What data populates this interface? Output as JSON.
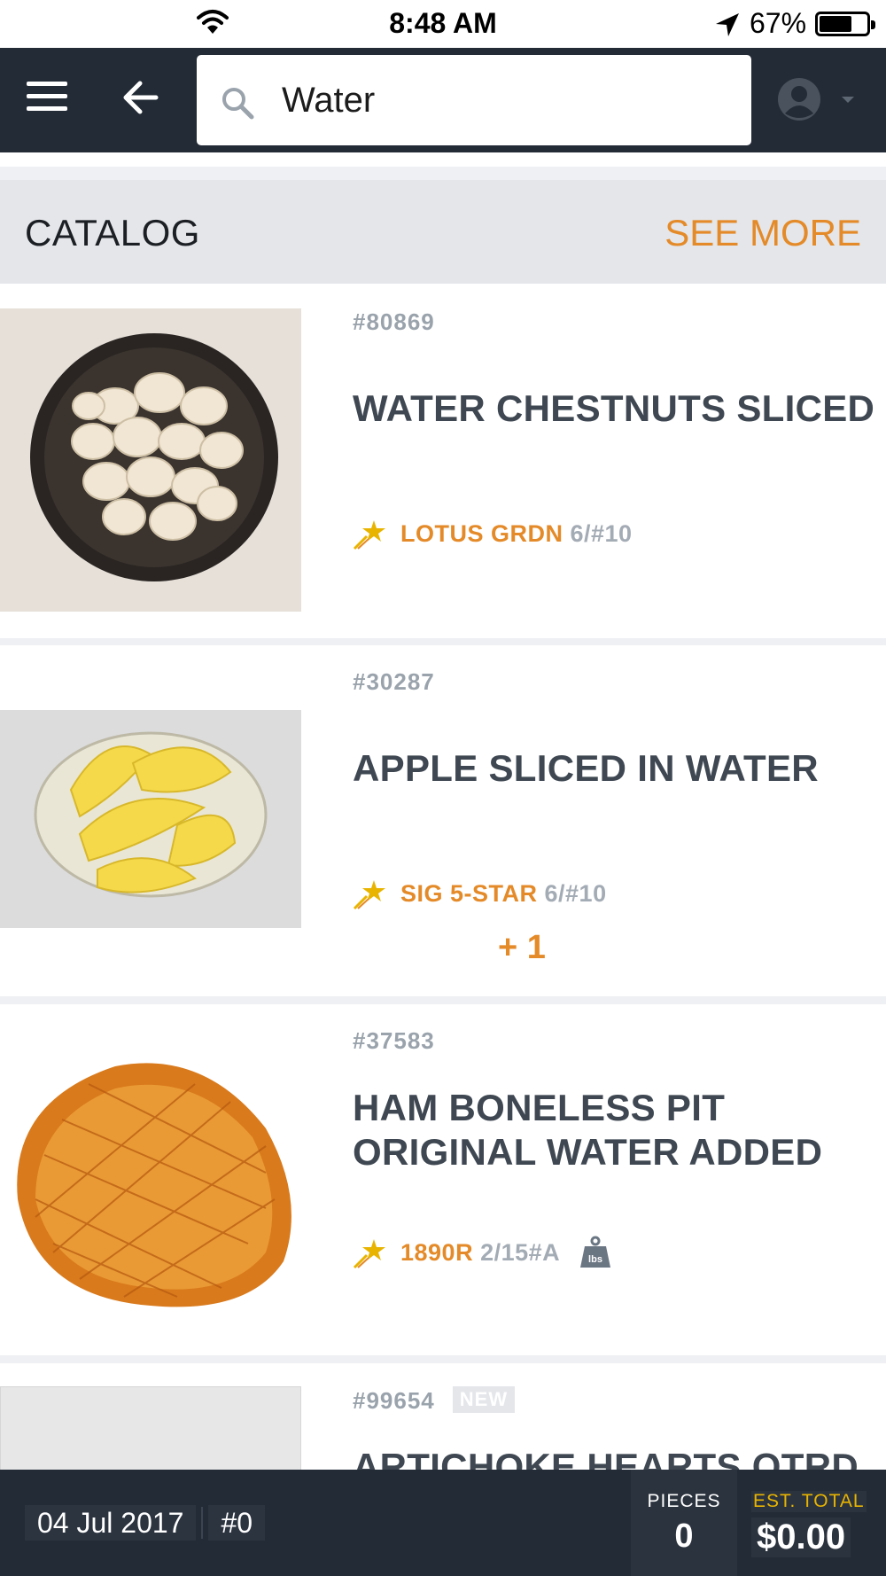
{
  "status_bar": {
    "time": "8:48 AM",
    "battery": "67%"
  },
  "header": {
    "search_value": "Water",
    "icons": [
      "menu-icon",
      "back-arrow-icon",
      "search-icon",
      "account-icon",
      "caret-down-icon"
    ]
  },
  "catalog": {
    "title": "CATALOG",
    "see_more": "SEE MORE",
    "items": [
      {
        "item_no": "#80869",
        "name": "WATER CHESTNUTS SLICED",
        "brand": "LOTUS GRDN",
        "pack": "6/#10"
      },
      {
        "item_no": "#30287",
        "name": "APPLE SLICED IN WATER",
        "brand": "SIG 5-STAR",
        "pack": "6/#10",
        "more": "+ 1"
      },
      {
        "item_no": "#37583",
        "name": "HAM BONELESS PIT ORIGINAL WATER ADDED",
        "brand": "1890R",
        "pack": "2/15#A",
        "weight_badge": "lbs"
      },
      {
        "item_no": "#99654",
        "badge": "NEW",
        "name": "ARTICHOKE HEARTS QTRD"
      }
    ]
  },
  "bottom_bar": {
    "date": "04 Jul 2017",
    "order": "#0",
    "pieces_label": "PIECES",
    "pieces_value": "0",
    "total_label": "EST. TOTAL",
    "total_value": "$0.00"
  },
  "colors": {
    "header_bg": "#232b36",
    "accent_orange": "#e48a28",
    "total_label_yellow": "#e8b400",
    "text_dark": "#3f4852",
    "text_muted": "#9aa3ac"
  }
}
